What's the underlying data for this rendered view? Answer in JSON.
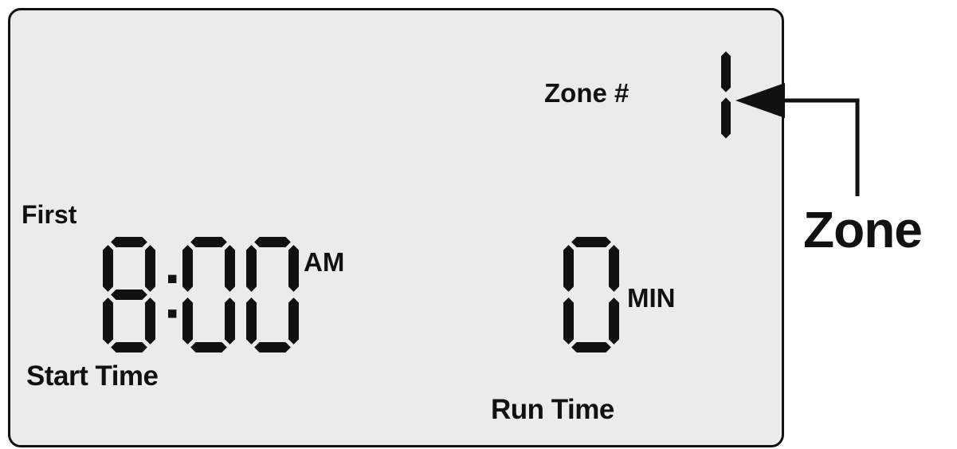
{
  "display": {
    "zone_label": "Zone #",
    "zone_number": "1",
    "first_label": "First",
    "start_time": "8:00",
    "start_time_period": "AM",
    "start_time_label": "Start Time",
    "run_time": "0",
    "run_time_unit": "MIN",
    "run_time_label": "Run Time"
  },
  "callout": {
    "label": "Zone"
  },
  "colors": {
    "lcd_background": "#ebebeb",
    "segment_ink": "#111111",
    "page_background": "#ffffff"
  }
}
